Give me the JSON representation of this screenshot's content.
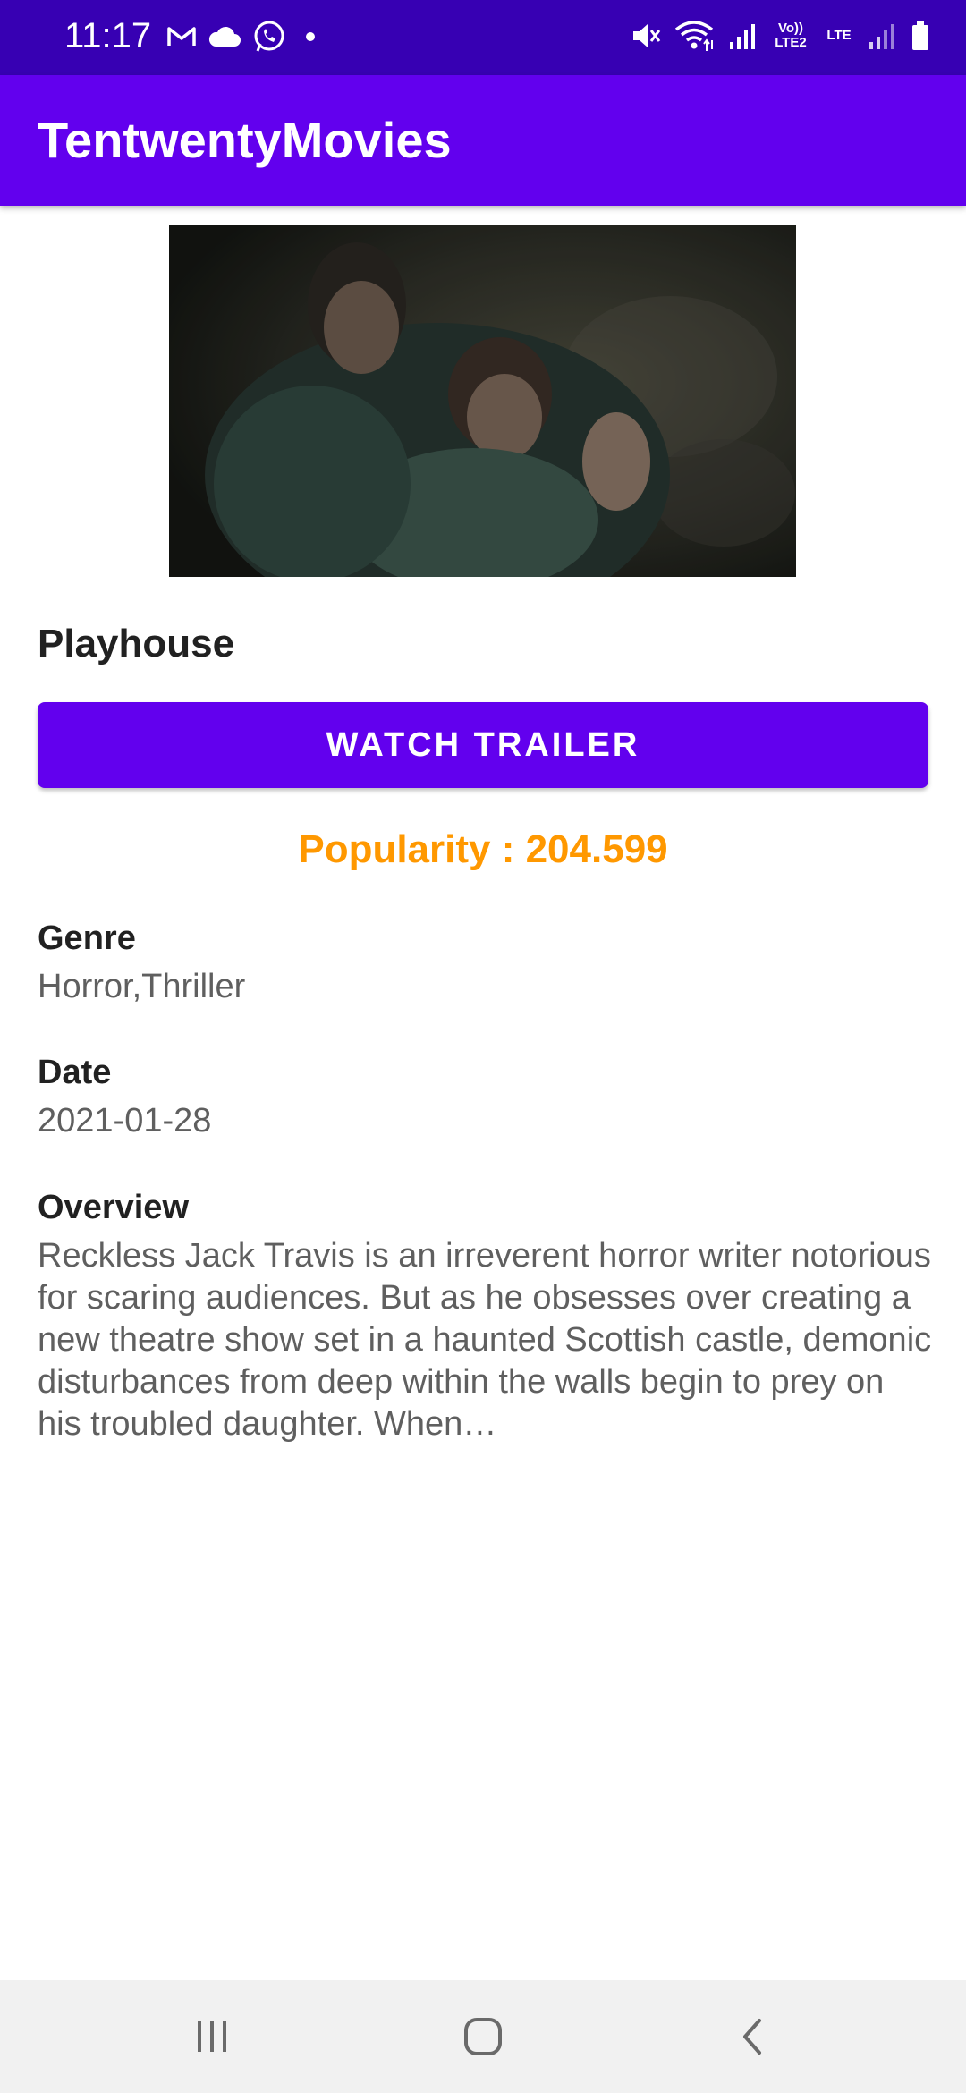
{
  "status_bar": {
    "time": "11:17",
    "left_icons": [
      "gmail-icon",
      "cloud-icon",
      "whatsapp-icon",
      "dot-icon"
    ],
    "right_icons": [
      "mute-icon",
      "wifi-icon",
      "signal-icon",
      "volte-lte2-icon",
      "lte-icon",
      "signal-icon",
      "battery-icon"
    ],
    "volte_label": "Vo)) LTE2",
    "lte_label": "LTE"
  },
  "app_bar": {
    "title": "TentwentyMovies"
  },
  "movie": {
    "title": "Playhouse",
    "trailer_button_label": "WATCH TRAILER",
    "popularity": "Popularity : 204.599",
    "genre_label": "Genre",
    "genre_value": "Horror,Thriller",
    "date_label": "Date",
    "date_value": "2021-01-28",
    "overview_label": "Overview",
    "overview_text": "Reckless Jack Travis is an irreverent horror writer notorious for scaring audiences. But as he obsesses over creating a new theatre show set in a haunted Scottish castle, demonic disturbances from deep within the walls begin to prey on his troubled daughter. When…"
  },
  "nav_bar": {
    "icons": [
      "recents-icon",
      "home-icon",
      "back-icon"
    ]
  },
  "colors": {
    "status_bar": "#3700b3",
    "primary": "#6200ee",
    "popularity": "#ff9800",
    "nav_bar": "#f1f1f1"
  }
}
